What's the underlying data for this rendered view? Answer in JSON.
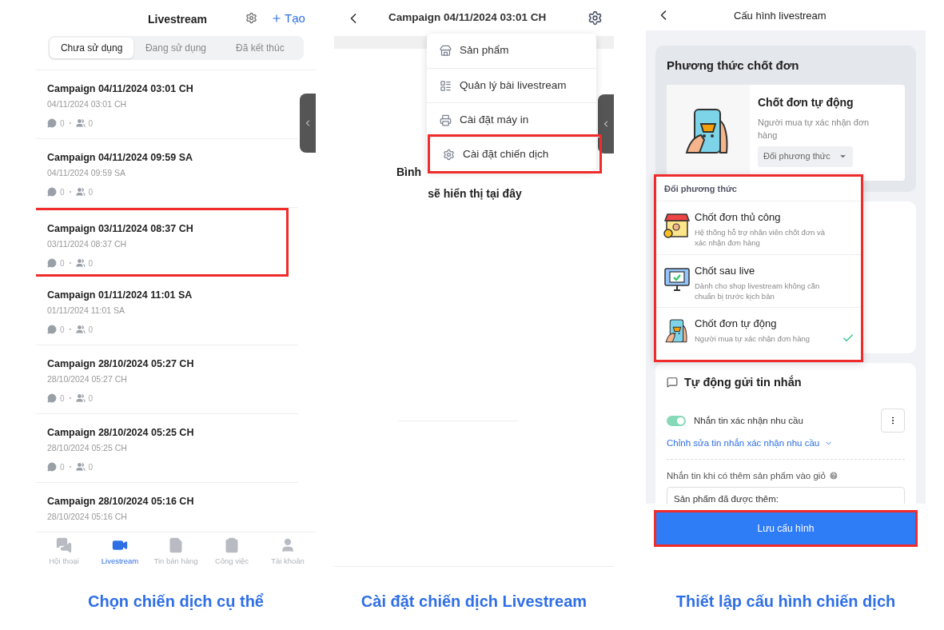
{
  "list_screen": {
    "title": "Livestream",
    "create_label": "Tạo",
    "tabs": [
      {
        "label": "Chưa sử dụng",
        "selected": true
      },
      {
        "label": "Đang sử dụng",
        "selected": false
      },
      {
        "label": "Đã kết thúc",
        "selected": false
      }
    ],
    "campaigns": [
      {
        "title": "Campaign 04/11/2024 03:01 CH",
        "date": "04/11/2024 03:01 CH",
        "comments": "0",
        "viewers": "0",
        "highlighted": false
      },
      {
        "title": "Campaign 04/11/2024 09:59 SA",
        "date": "04/11/2024 09:59 SA",
        "comments": "0",
        "viewers": "0",
        "highlighted": false
      },
      {
        "title": "Campaign 03/11/2024 08:37 CH",
        "date": "03/11/2024 08:37 CH",
        "comments": "0",
        "viewers": "0",
        "highlighted": true
      },
      {
        "title": "Campaign 01/11/2024 11:01 SA",
        "date": "01/11/2024 11:01 SA",
        "comments": "0",
        "viewers": "0",
        "highlighted": false
      },
      {
        "title": "Campaign 28/10/2024 05:27 CH",
        "date": "28/10/2024 05:27 CH",
        "comments": "0",
        "viewers": "0",
        "highlighted": false
      },
      {
        "title": "Campaign 28/10/2024 05:25 CH",
        "date": "28/10/2024 05:25 CH",
        "comments": "0",
        "viewers": "0",
        "highlighted": false
      },
      {
        "title": "Campaign 28/10/2024 05:16 CH",
        "date": "28/10/2024 05:16 CH",
        "highlighted": false
      }
    ],
    "nav": [
      {
        "label": "Hội thoại",
        "selected": false
      },
      {
        "label": "Livestream",
        "selected": true
      },
      {
        "label": "Tin bán hàng",
        "selected": false
      },
      {
        "label": "Công việc",
        "selected": false
      },
      {
        "label": "Tài khoản",
        "selected": false
      }
    ],
    "caption": "Chọn chiến dịch cụ thể"
  },
  "campaign_screen": {
    "title": "Campaign 04/11/2024 03:01 CH",
    "empty_line_1": "Bình",
    "empty_line_2": "sẽ hiển thị tại đây",
    "menu": [
      {
        "label": "Sản phẩm",
        "highlighted": false
      },
      {
        "label": "Quản lý bài livestream",
        "highlighted": false
      },
      {
        "label": "Cài đặt máy in",
        "highlighted": false
      },
      {
        "label": "Cài đặt chiến dịch",
        "highlighted": true
      }
    ],
    "caption": "Cài đặt chiến dịch Livestream"
  },
  "config_screen": {
    "title": "Cấu hình livestream",
    "method_card": {
      "heading": "Phương thức chốt đơn",
      "current_title": "Chốt đơn tự động",
      "current_desc": "Người mua tự xác nhận đơn hàng",
      "change_button": "Đổi phương thức"
    },
    "dropdown": {
      "heading": "Đổi phương thức",
      "highlighted": true,
      "options": [
        {
          "title": "Chốt đơn thủ công",
          "desc": "Hệ thống hỗ trợ nhân viên chốt đơn và xác nhận đơn hàng",
          "selected": false
        },
        {
          "title": "Chốt sau live",
          "desc": "Dành cho shop livestream không cần chuẩn bị trước kịch bản",
          "selected": false
        },
        {
          "title": "Chốt đơn tự động",
          "desc": "Người mua tự xác nhận đơn hàng",
          "selected": true
        }
      ]
    },
    "messages_card": {
      "heading": "Tự động gửi tin nhắn",
      "toggle": {
        "label": "Nhắn tin xác nhận nhu cầu",
        "on": true
      },
      "edit_link": "Chỉnh sửa tin nhắn xác nhận nhu cầu",
      "cart_label": "Nhắn tin khi có thêm sản phẩm vào giỏ",
      "cart_value": "Sản phẩm đã được thêm:"
    },
    "save_button": {
      "label": "Lưu cấu hình",
      "highlighted": true
    },
    "caption": "Thiết lập cấu hình chiến dịch"
  }
}
